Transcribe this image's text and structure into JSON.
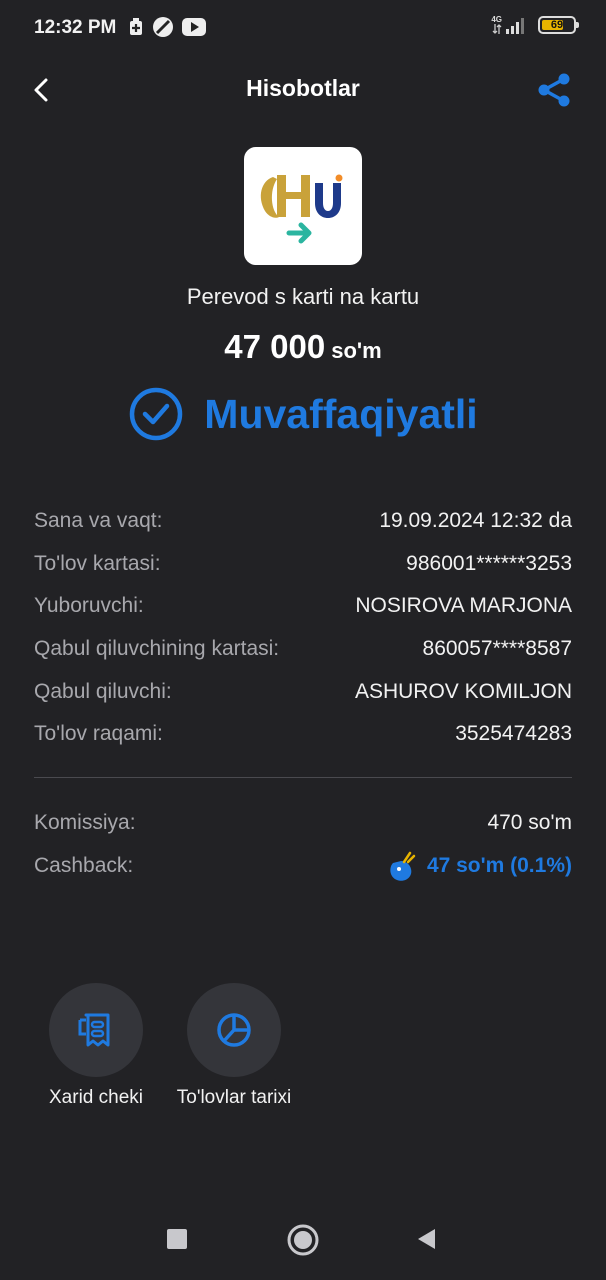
{
  "status_bar": {
    "time": "12:32 PM",
    "network": "4G",
    "battery": "69",
    "battery_level": 0.69
  },
  "header": {
    "title": "Hisobotlar",
    "back_icon": "chevron-left-icon",
    "share_icon": "share-icon"
  },
  "transaction": {
    "name": "Perevod s karti na kartu",
    "amount": "47 000",
    "currency": "so'm",
    "status": "Muvaffaqiyatli",
    "status_color": "#1f7ae0"
  },
  "details": [
    {
      "label": "Sana va vaqt:",
      "value": "19.09.2024 12:32 da"
    },
    {
      "label": "To'lov kartasi:",
      "value": "986001******3253"
    },
    {
      "label": "Yuboruvchi:",
      "value": "NOSIROVA MARJONA"
    },
    {
      "label": "Qabul qiluvchining kartasi:",
      "value": "860057****8587"
    },
    {
      "label": "Qabul qiluvchi:",
      "value": "ASHUROV KOMILJON"
    },
    {
      "label": "To'lov raqami:",
      "value": "3525474283"
    }
  ],
  "fees": {
    "commission_label": "Komissiya:",
    "commission_value": "470 so'm",
    "cashback_label": "Cashback:",
    "cashback_value": "47 so'm (0.1%)"
  },
  "actions": [
    {
      "label": "Xarid cheki",
      "icon": "receipt-icon"
    },
    {
      "label": "To'lovlar tarixi",
      "icon": "pie-chart-icon"
    }
  ],
  "colors": {
    "accent": "#1f7ae0",
    "background": "#222225"
  }
}
